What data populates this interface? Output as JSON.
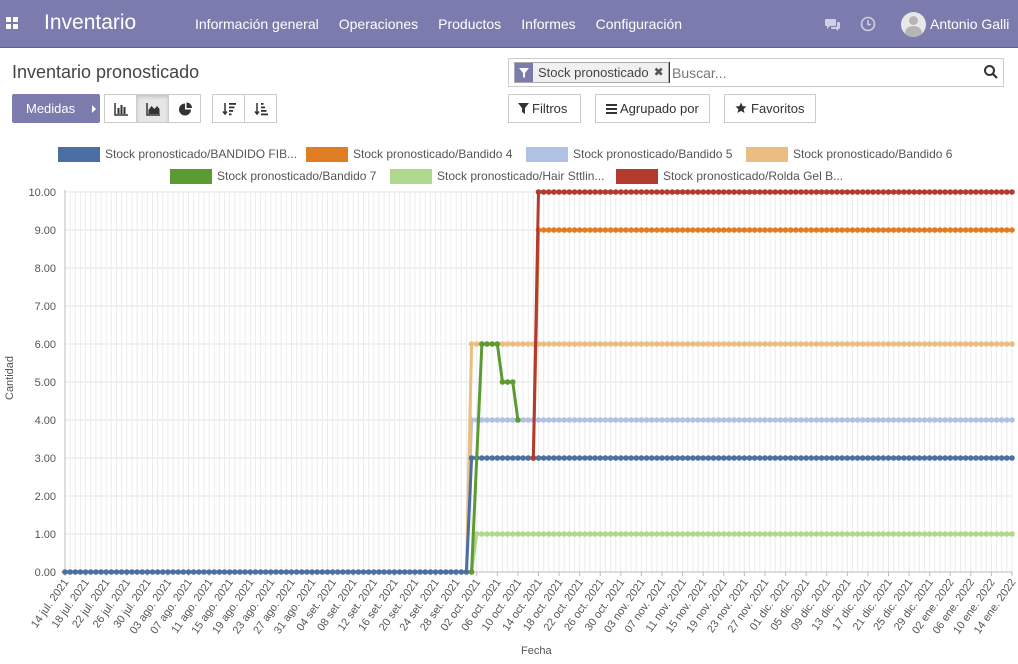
{
  "navbar": {
    "brand": "Inventario",
    "menu": [
      "Información general",
      "Operaciones",
      "Productos",
      "Informes",
      "Configuración"
    ],
    "user_name": "Antonio Galli",
    "icons": [
      "apps-icon",
      "chat-icon",
      "clock-icon",
      "avatar"
    ]
  },
  "control_panel": {
    "title": "Inventario pronosticado",
    "facet_label": "Stock pronosticado",
    "search_placeholder": "Buscar...",
    "measures_label": "Medidas",
    "filters_label": "Filtros",
    "groupby_label": "Agrupado por",
    "favorites_label": "Favoritos",
    "accent": "#7c7bad"
  },
  "chart_data": {
    "type": "line",
    "xlabel": "Fecha",
    "ylabel": "Cantidad",
    "ylim": [
      0,
      10
    ],
    "yticks": [
      "0.00",
      "1.00",
      "2.00",
      "3.00",
      "4.00",
      "5.00",
      "6.00",
      "7.00",
      "8.00",
      "9.00",
      "10.00"
    ],
    "x_start": "2021-07-14",
    "x_end": "2022-01-14",
    "xticks": [
      "14 jul. 2021",
      "18 jul. 2021",
      "22 jul. 2021",
      "26 jul. 2021",
      "30 jul. 2021",
      "03 ago. 2021",
      "07 ago. 2021",
      "11 ago. 2021",
      "15 ago. 2021",
      "19 ago. 2021",
      "23 ago. 2021",
      "27 ago. 2021",
      "31 ago. 2021",
      "04 set. 2021",
      "08 set. 2021",
      "12 set. 2021",
      "16 set. 2021",
      "20 set. 2021",
      "24 set. 2021",
      "28 set. 2021",
      "02 oct. 2021",
      "06 oct. 2021",
      "10 oct. 2021",
      "14 oct. 2021",
      "18 oct. 2021",
      "22 oct. 2021",
      "26 oct. 2021",
      "30 oct. 2021",
      "03 nov. 2021",
      "07 nov. 2021",
      "11 nov. 2021",
      "15 nov. 2021",
      "19 nov. 2021",
      "23 nov. 2021",
      "27 nov. 2021",
      "01 dic. 2021",
      "05 dic. 2021",
      "09 dic. 2021",
      "13 dic. 2021",
      "17 dic. 2021",
      "21 dic. 2021",
      "25 dic. 2021",
      "29 dic. 2021",
      "02 ene. 2022",
      "06 ene. 2022",
      "10 ene. 2022",
      "14 ene. 2022"
    ],
    "legend_position": "top",
    "grid": true,
    "series": [
      {
        "name": "Stock pronosticado/BANDIDO FIB...",
        "color": "#4a6fa5",
        "segments": [
          {
            "x": "2021-07-14",
            "y": 0
          },
          {
            "x": "2021-09-30",
            "y": 0
          },
          {
            "x": "2021-10-01",
            "y": 3
          },
          {
            "x": "2022-01-14",
            "y": 3
          }
        ]
      },
      {
        "name": "Stock pronosticado/Bandido 4",
        "color": "#e07d22",
        "segments": [
          {
            "x": "2021-10-13",
            "y": 3
          },
          {
            "x": "2021-10-14",
            "y": 9
          },
          {
            "x": "2022-01-14",
            "y": 9
          }
        ]
      },
      {
        "name": "Stock pronosticado/Bandido 5",
        "color": "#b0c1e3",
        "segments": [
          {
            "x": "2021-09-30",
            "y": 0
          },
          {
            "x": "2021-10-01",
            "y": 4
          },
          {
            "x": "2022-01-14",
            "y": 4
          }
        ]
      },
      {
        "name": "Stock pronosticado/Bandido 6",
        "color": "#ecbd80",
        "segments": [
          {
            "x": "2021-09-30",
            "y": 0
          },
          {
            "x": "2021-10-01",
            "y": 6
          },
          {
            "x": "2022-01-14",
            "y": 6
          }
        ]
      },
      {
        "name": "Stock pronosticado/Bandido 7",
        "color": "#5c9b32",
        "segments": [
          {
            "x": "2021-10-01",
            "y": 0
          },
          {
            "x": "2021-10-03",
            "y": 6
          },
          {
            "x": "2021-10-06",
            "y": 6
          },
          {
            "x": "2021-10-07",
            "y": 5
          },
          {
            "x": "2021-10-09",
            "y": 5
          },
          {
            "x": "2021-10-10",
            "y": 4
          }
        ]
      },
      {
        "name": "Stock pronosticado/Hair Sttlin...",
        "color": "#aed88e",
        "segments": [
          {
            "x": "2021-10-01",
            "y": 0
          },
          {
            "x": "2021-10-02",
            "y": 1
          },
          {
            "x": "2022-01-14",
            "y": 1
          }
        ]
      },
      {
        "name": "Stock pronosticado/Rolda Gel B...",
        "color": "#b23a2e",
        "segments": [
          {
            "x": "2021-10-13",
            "y": 3
          },
          {
            "x": "2021-10-14",
            "y": 10
          },
          {
            "x": "2022-01-14",
            "y": 10
          }
        ]
      }
    ]
  }
}
